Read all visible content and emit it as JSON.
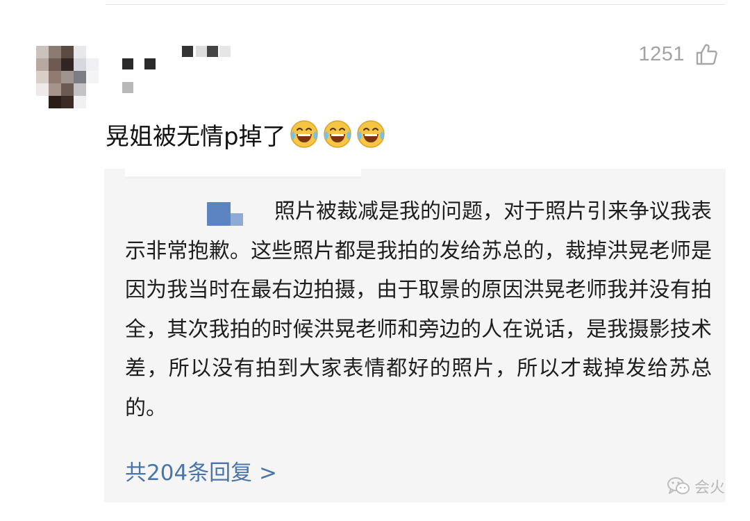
{
  "comment": {
    "likes": "1251",
    "text": "晃姐被无情p掉了",
    "emojis": [
      "laugh-cry-emoji",
      "laugh-cry-emoji",
      "laugh-cry-emoji"
    ]
  },
  "reply": {
    "text": "照片被裁减是我的问题，对于照片引来争议我表示非常抱歉。这些照片都是我拍的发给苏总的，裁掉洪晃老师是因为我当时在最右边拍摄，由于取景的原因洪晃老师我并没有拍全，其次我拍的时候洪晃老师和旁边的人在说话，是我摄影技术差，所以没有拍到大家表情都好的照片，所以才裁掉发给苏总的。",
    "more_link": "共204条回复 >"
  },
  "watermark": {
    "text": "会火",
    "icon": "wechat-icon"
  },
  "colors": {
    "link": "#4a75a8",
    "reply_background": "#f5f5f5",
    "muted": "#a3a3a3"
  }
}
